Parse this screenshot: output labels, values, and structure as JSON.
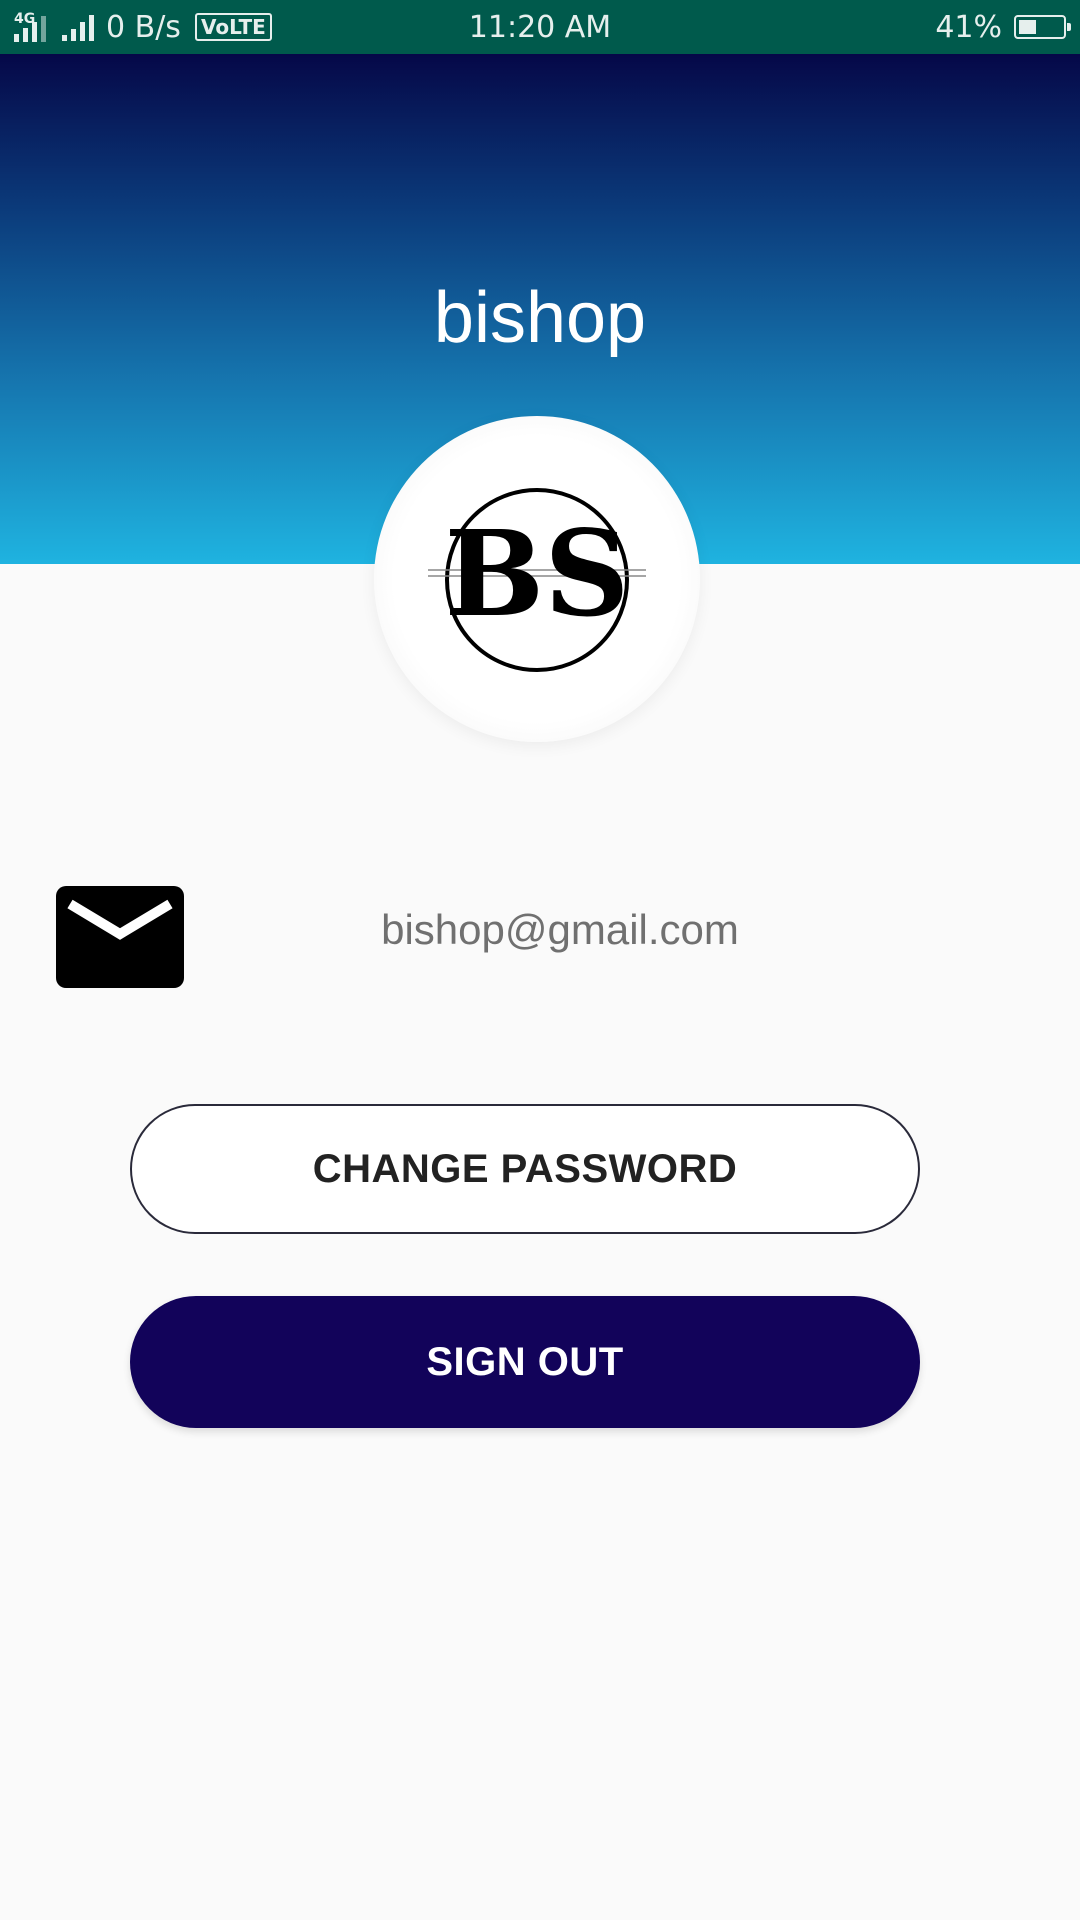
{
  "status_bar": {
    "network_type": "4G",
    "data_speed": "0 B/s",
    "volte": "VoLTE",
    "time": "11:20 AM",
    "battery_percent": "41%",
    "battery_level": 0.41,
    "color": "#005a4c"
  },
  "profile": {
    "user_name": "bishop",
    "avatar_monogram": "BS",
    "email": "bishop@gmail.com",
    "email_icon": "mail-icon"
  },
  "actions": {
    "change_password_label": "CHANGE PASSWORD",
    "sign_out_label": "SIGN OUT"
  },
  "colors": {
    "header_gradient_top": "#050848",
    "header_gradient_bottom": "#1fb3e0",
    "sign_out_bg": "#12035a",
    "page_bg": "#fafafa"
  }
}
